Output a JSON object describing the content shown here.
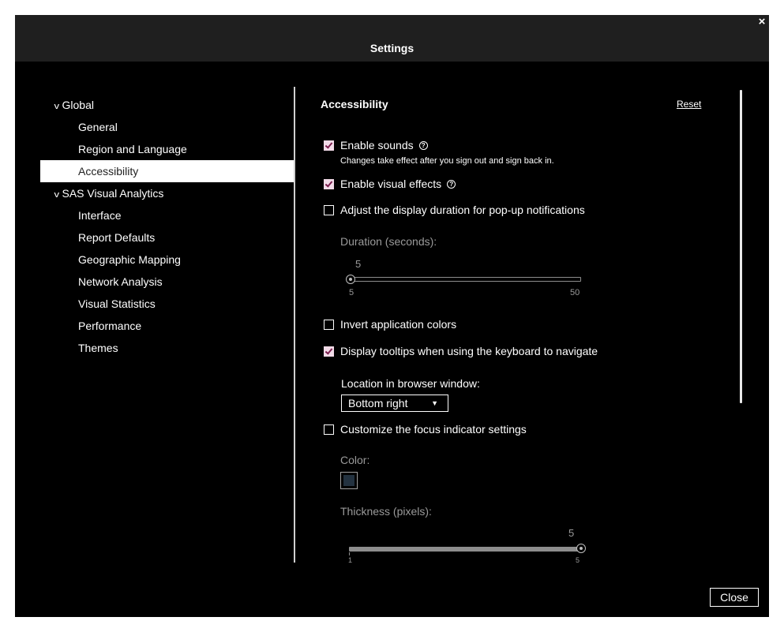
{
  "dialog": {
    "title": "Settings",
    "close_x": "×",
    "close_button": "Close"
  },
  "nav": {
    "items": [
      {
        "label": "Global",
        "level": "group",
        "expanded": true
      },
      {
        "label": "General",
        "level": "child"
      },
      {
        "label": "Region and Language",
        "level": "child"
      },
      {
        "label": "Accessibility",
        "level": "child",
        "selected": true
      },
      {
        "label": "SAS Visual Analytics",
        "level": "group",
        "expanded": true
      },
      {
        "label": "Interface",
        "level": "child"
      },
      {
        "label": "Report Defaults",
        "level": "child"
      },
      {
        "label": "Geographic Mapping",
        "level": "child"
      },
      {
        "label": "Network Analysis",
        "level": "child"
      },
      {
        "label": "Visual Statistics",
        "level": "child"
      },
      {
        "label": "Performance",
        "level": "child"
      },
      {
        "label": "Themes",
        "level": "child"
      }
    ]
  },
  "panel": {
    "heading": "Accessibility",
    "reset": "Reset",
    "enable_sounds": {
      "label": "Enable sounds",
      "checked": true,
      "note": "Changes take effect after you sign out and sign back in."
    },
    "enable_visual_effects": {
      "label": "Enable visual effects",
      "checked": true
    },
    "adjust_duration": {
      "label": "Adjust the display duration for pop-up notifications",
      "checked": false
    },
    "duration": {
      "label": "Duration (seconds):",
      "value": "5",
      "min": "5",
      "max": "50"
    },
    "invert_colors": {
      "label": "Invert application colors",
      "checked": false
    },
    "display_tooltips": {
      "label": "Display tooltips when using the keyboard to navigate",
      "checked": true
    },
    "location": {
      "label": "Location in browser window:",
      "value": "Bottom right",
      "arrow": "▼"
    },
    "customize_focus": {
      "label": "Customize the focus indicator settings",
      "checked": false
    },
    "color": {
      "label": "Color:",
      "value": "#233240"
    },
    "thickness": {
      "label": "Thickness (pixels):",
      "value": "5",
      "min": "1",
      "max": "5"
    }
  },
  "colors": {
    "background": "#000000",
    "titlebar": "#1f1f1f",
    "checkbox_checked": "#f2dbe8",
    "check_mark": "#7a1d4d"
  },
  "icons": {
    "chevron": "chevron-down-icon",
    "help": "help-circle-icon",
    "close": "close-icon"
  }
}
